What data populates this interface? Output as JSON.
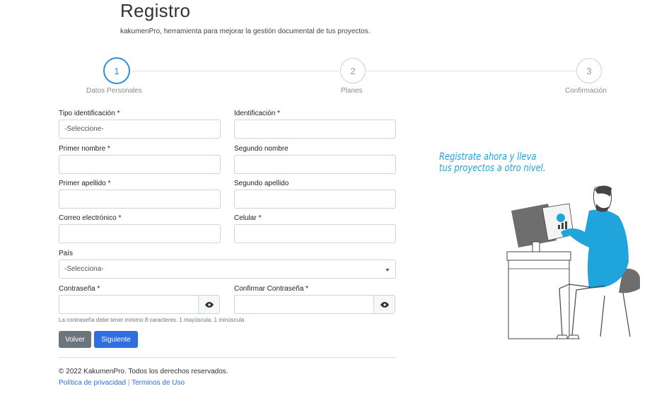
{
  "header": {
    "title": "Registro",
    "subtitle": "kakumenPro, herramienta para mejorar la gestión documental de tus proyectos."
  },
  "stepper": {
    "steps": [
      {
        "number": "1",
        "label": "Datos Personales",
        "active": true
      },
      {
        "number": "2",
        "label": "Planes",
        "active": false
      },
      {
        "number": "3",
        "label": "Confirmación",
        "active": false
      }
    ],
    "active_color": "#2d8fd6"
  },
  "form": {
    "tipo_identificacion": {
      "label": "Tipo identificación *",
      "value": "-Seleccione-"
    },
    "identificacion": {
      "label": "Identificación *",
      "value": ""
    },
    "primer_nombre": {
      "label": "Primer nombre *",
      "value": ""
    },
    "segundo_nombre": {
      "label": "Segundo nombre",
      "value": ""
    },
    "primer_apellido": {
      "label": "Primer apellido *",
      "value": ""
    },
    "segundo_apellido": {
      "label": "Segundo apellido",
      "value": ""
    },
    "correo": {
      "label": "Correo electrónico *",
      "value": ""
    },
    "celular": {
      "label": "Celular *",
      "value": ""
    },
    "pais": {
      "label": "País",
      "value": "-Selecciona-"
    },
    "contrasena": {
      "label": "Contraseña *",
      "value": ""
    },
    "confirmar_contrasena": {
      "label": "Confirmar Contraseña *",
      "value": ""
    },
    "password_hint": "La contraseña debe tener mínimo 8 caracteres. 1 mayúscula. 1 minúscula"
  },
  "buttons": {
    "back_label": "Volver",
    "next_label": "Siguiente",
    "next_color": "#2e6ee0",
    "back_color": "#6c757d"
  },
  "footer": {
    "copyright": "© 2022 KakumenPro. Todos los derechos reservados.",
    "privacy_link": "Política de privacidad",
    "separator": "|",
    "terms_link": "Terminos de Uso"
  },
  "promo": {
    "text": "Registrate ahora y lleva tus proyectos a otro nivel."
  },
  "icons": {
    "eye": "eye-icon",
    "caret": "chevron-down-icon"
  }
}
